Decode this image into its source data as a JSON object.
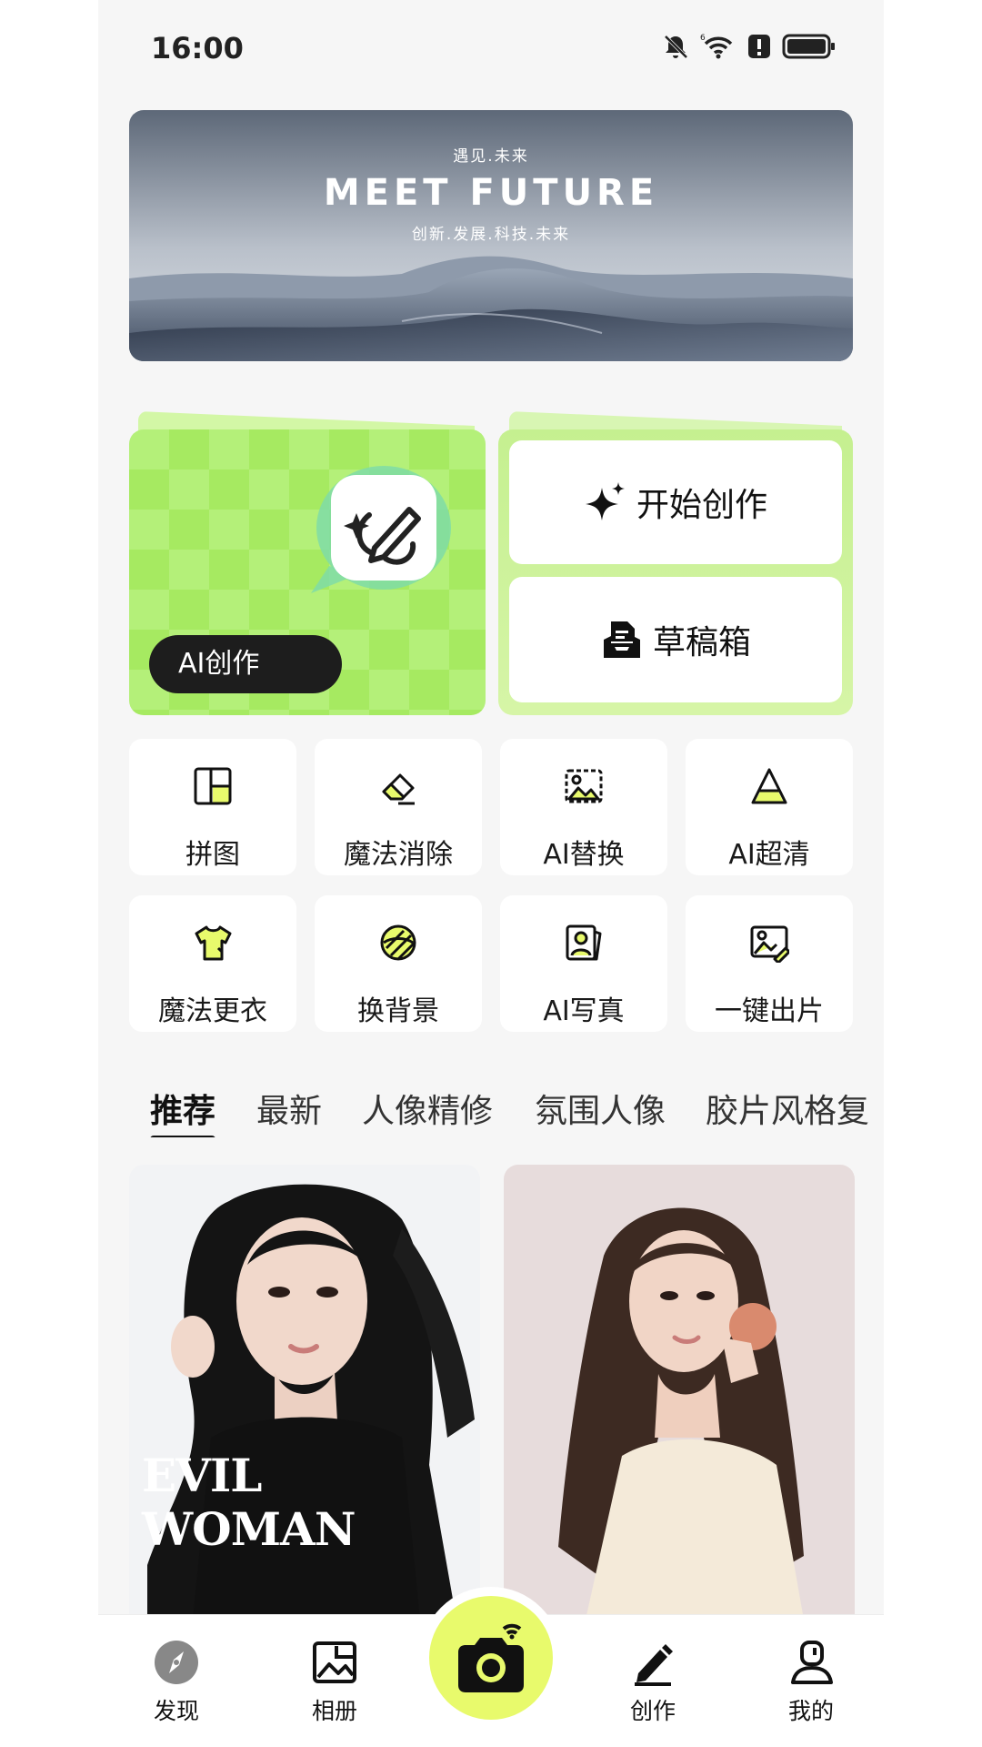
{
  "status_bar": {
    "time": "16:00",
    "icons": [
      "mute-icon",
      "wifi-6-icon",
      "alert-icon",
      "battery-icon"
    ]
  },
  "banner": {
    "top_text": "遇见.未来",
    "headline": "MEET FUTURE",
    "sub_text": "创新.发展.科技.未来"
  },
  "ai_card": {
    "label": "AI创作",
    "icon": "ai-pen-sparkle-icon"
  },
  "actions": {
    "start_label": "开始创作",
    "draft_label": "草稿箱"
  },
  "tools": [
    {
      "label": "拼图",
      "icon": "collage-icon"
    },
    {
      "label": "魔法消除",
      "icon": "eraser-icon"
    },
    {
      "label": "AI替换",
      "icon": "image-replace-icon"
    },
    {
      "label": "AI超清",
      "icon": "enhance-triangle-icon"
    },
    {
      "label": "魔法更衣",
      "icon": "shirt-icon"
    },
    {
      "label": "换背景",
      "icon": "background-swap-icon"
    },
    {
      "label": "AI写真",
      "icon": "portrait-icon"
    },
    {
      "label": "一键出片",
      "icon": "one-click-photo-icon"
    }
  ],
  "category_tabs": [
    {
      "label": "推荐",
      "active": true
    },
    {
      "label": "最新",
      "active": false
    },
    {
      "label": "人像精修",
      "active": false
    },
    {
      "label": "氛围人像",
      "active": false
    },
    {
      "label": "胶片风格复",
      "active": false
    }
  ],
  "feed": [
    {
      "overlay_text": "EVIL WOMAN"
    },
    {
      "overlay_text": ""
    }
  ],
  "bottom_nav": {
    "items": [
      {
        "label": "发现",
        "icon": "compass-icon"
      },
      {
        "label": "相册",
        "icon": "album-icon"
      },
      {
        "label": "创作",
        "icon": "pen-icon"
      },
      {
        "label": "我的",
        "icon": "profile-icon"
      }
    ],
    "center_icon": "camera-icon"
  },
  "colors": {
    "accent_green": "#b4f079",
    "camera_yellow": "#e8fa6c",
    "background": "#f6f6f6"
  }
}
